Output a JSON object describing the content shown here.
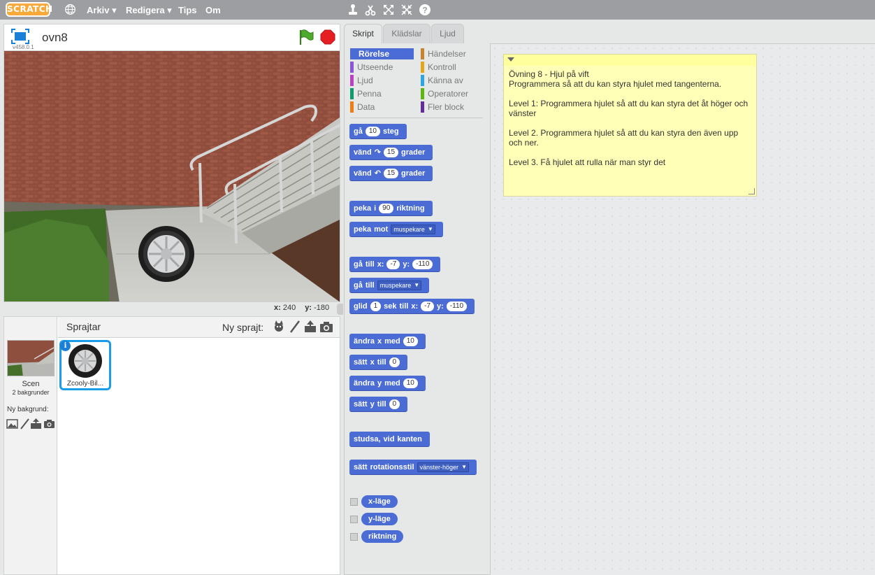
{
  "topbar": {
    "logo": "SCRATCH",
    "menus": [
      "Arkiv ▾",
      "Redigera ▾",
      "Tips",
      "Om"
    ]
  },
  "stage": {
    "title": "ovn8",
    "version": "v458.0.1",
    "x_label": "x:",
    "x_value": "240",
    "y_label": "y:",
    "y_value": "-180"
  },
  "sprites": {
    "title": "Sprajtar",
    "new_sprite_label": "Ny sprajt:",
    "scene_label": "Scen",
    "scene_sub": "2 bakgrunder",
    "new_backdrop_label": "Ny bakgrund:",
    "sprite_name": "Zcooly-Bil..."
  },
  "tabs": [
    "Skript",
    "Klädslar",
    "Ljud"
  ],
  "categories": [
    {
      "label": "Rörelse",
      "color": "#4a6cd4"
    },
    {
      "label": "Utseende",
      "color": "#8a55d7"
    },
    {
      "label": "Ljud",
      "color": "#bb42c3"
    },
    {
      "label": "Penna",
      "color": "#0e9a6c"
    },
    {
      "label": "Data",
      "color": "#ee7d16"
    },
    {
      "label": "Händelser",
      "color": "#c88330"
    },
    {
      "label": "Kontroll",
      "color": "#e1a91a"
    },
    {
      "label": "Känna av",
      "color": "#2ca5e2"
    },
    {
      "label": "Operatorer",
      "color": "#5cb712"
    },
    {
      "label": "Fler block",
      "color": "#632d99"
    }
  ],
  "blocks": {
    "b1": {
      "w1": "gå",
      "n1": "10",
      "w2": "steg"
    },
    "b2": {
      "w1": "vänd",
      "n1": "15",
      "w2": "grader"
    },
    "b3": {
      "w1": "vänd",
      "n1": "15",
      "w2": "grader"
    },
    "b4": {
      "w1": "peka",
      "w2": "i",
      "n1": "90",
      "w3": "riktning"
    },
    "b5": {
      "w1": "peka",
      "w2": "mot",
      "d1": "muspekare"
    },
    "b6": {
      "w1": "gå",
      "w2": "till",
      "w3": "x:",
      "n1": "-7",
      "w4": "y:",
      "n2": "-110"
    },
    "b7": {
      "w1": "gå",
      "w2": "till",
      "d1": "muspekare"
    },
    "b8": {
      "w1": "glid",
      "n1": "1",
      "w2": "sek",
      "w3": "till",
      "w4": "x:",
      "n2": "-7",
      "w5": "y:",
      "n3": "-110"
    },
    "b9": {
      "w1": "ändra",
      "w2": "x",
      "w3": "med",
      "n1": "10"
    },
    "b10": {
      "w1": "sätt",
      "w2": "x",
      "w3": "till",
      "n1": "0"
    },
    "b11": {
      "w1": "ändra",
      "w2": "y",
      "w3": "med",
      "n1": "10"
    },
    "b12": {
      "w1": "sätt",
      "w2": "y",
      "w3": "till",
      "n1": "0"
    },
    "b13": {
      "w1": "studsa,",
      "w2": "vid",
      "w3": "kanten"
    },
    "b14": {
      "w1": "sätt",
      "w2": "rotationsstil",
      "d1": "vänster-höger"
    },
    "r1": "x-läge",
    "r2": "y-läge",
    "r3": "riktning"
  },
  "note": {
    "text": "Övning 8 - Hjul på vift\nProgrammera så att du kan styra hjulet med tangenterna.\n\nLevel 1: Programmera hjulet så att du kan styra det åt höger och vänster\n\nLevel 2. Programmera hjulet så att du kan styra den även upp och ner.\n\nLevel 3. Få hjulet att rulla när man styr det"
  }
}
